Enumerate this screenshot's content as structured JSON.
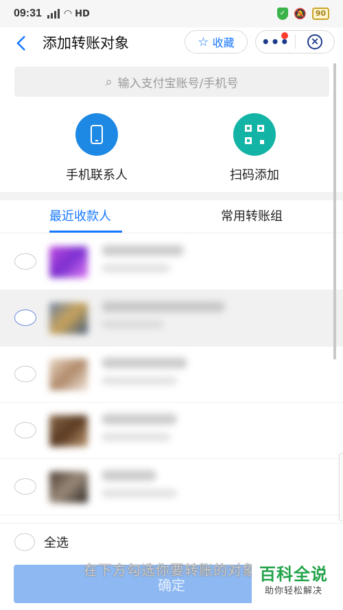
{
  "status_bar": {
    "time": "09:31",
    "network": "HD",
    "battery": "90"
  },
  "header": {
    "title": "添加转账对象",
    "favorite_label": "收藏"
  },
  "search": {
    "placeholder": "输入支付宝账号/手机号"
  },
  "actions": [
    {
      "label": "手机联系人",
      "icon": "phone-icon",
      "color": "#1e88e5"
    },
    {
      "label": "扫码添加",
      "icon": "qr-code-icon",
      "color": "#13b4a6"
    }
  ],
  "tabs": [
    {
      "label": "最近收款人",
      "active": true
    },
    {
      "label": "常用转账组",
      "active": false
    }
  ],
  "recipients": [
    {
      "name": "",
      "account": "",
      "selected": false
    },
    {
      "name": "",
      "account": "",
      "selected": false
    },
    {
      "name": "",
      "account": "",
      "selected": false
    },
    {
      "name": "",
      "account": "",
      "selected": false
    },
    {
      "name": "",
      "account": "",
      "selected": false
    }
  ],
  "footer": {
    "select_all_label": "全选",
    "confirm_label": "确定",
    "caption": "在下方勾选你要转账的对象"
  },
  "watermark": {
    "main": "百科全说",
    "sub": "助你轻松解决"
  },
  "colors": {
    "accent": "#1677ff",
    "confirm_disabled": "#8db8f2",
    "watermark_green": "#23a34a"
  }
}
